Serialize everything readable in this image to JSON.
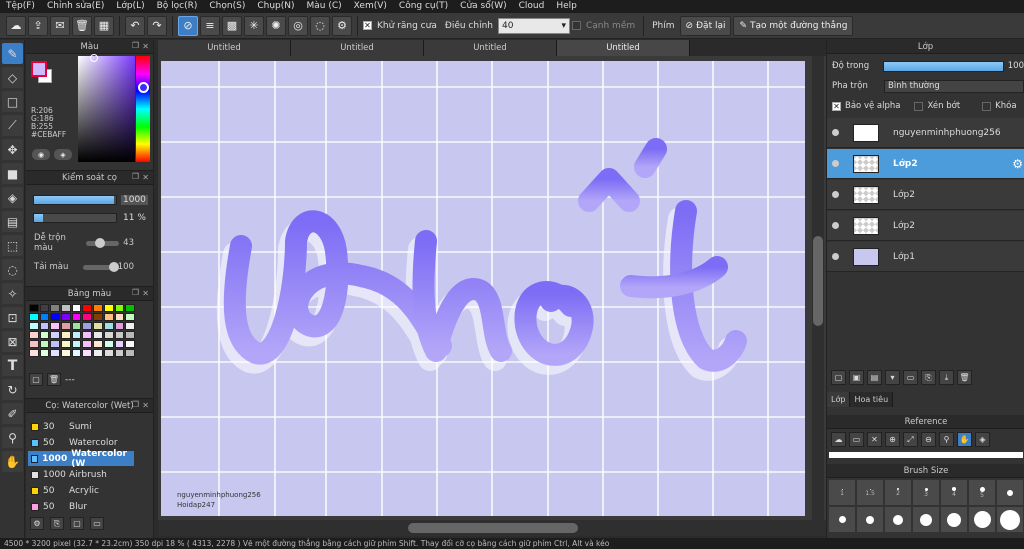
{
  "menu": [
    "Tệp(F)",
    "Chỉnh sửa(E)",
    "Lớp(L)",
    "Bộ lọc(R)",
    "Chọn(S)",
    "Chụp(N)",
    "Màu (C)",
    "Xem(V)",
    "Công cụ(T)",
    "Cửa sổ(W)",
    "Cloud",
    "Help"
  ],
  "toolbar": {
    "antialias_label": "Khử răng cưa",
    "correction_label": "Điều chỉnh",
    "correction_value": "40",
    "smooth_edge_label": "Cạnh mềm",
    "shortcut_label": "Phím",
    "reset_label": "Đặt lại",
    "straight_line_label": "Tạo một đường thẳng"
  },
  "color_panel": {
    "title": "Màu",
    "r": "R:206",
    "g": "G:186",
    "b": "B:255",
    "hex": "#CEBAFF",
    "fg_color": "#CEBAFF"
  },
  "brush_control": {
    "title": "Kiểm soát cọ",
    "size_value": "1000",
    "opacity_value": "11 %",
    "size_fill": 0.98,
    "opacity_fill": 0.11,
    "blend_label": "Dễ trộn màu",
    "blend_value": "43",
    "blend_fill": 0.43,
    "amount_label": "Tải màu",
    "amount_value": "100",
    "amount_fill": 1.0
  },
  "palette_panel": {
    "title": "Bảng màu",
    "footer_text": "---",
    "colors": [
      "#000000",
      "#404040",
      "#808080",
      "#c0c0c0",
      "#ffffff",
      "#ff0000",
      "#ff8000",
      "#ffff00",
      "#80ff00",
      "#00c000",
      "#00ffff",
      "#0080ff",
      "#0000ff",
      "#8000ff",
      "#ff00ff",
      "#ff0080",
      "#804000",
      "#ffc080",
      "#ffe0c0",
      "#c0ffc0",
      "#c0ffff",
      "#c0c0ff",
      "#ffc0ff",
      "#e0a0a0",
      "#a0e0a0",
      "#a0a0e0",
      "#e0e0a0",
      "#a0e0e0",
      "#e0a0e0",
      "#f0f0f0",
      "#ffd0d0",
      "#d0ffd0",
      "#d0d0ff",
      "#fff0c0",
      "#c0f0ff",
      "#f0c0ff",
      "#e8e8e8",
      "#d8d8d8",
      "#c8c8c8",
      "#b8b8b8",
      "#f8c0c0",
      "#c0f8c0",
      "#c0c0f8",
      "#f8f8c0",
      "#c0f8f8",
      "#f8c0f8",
      "#ffe8d0",
      "#d0ffe8",
      "#e8d0ff",
      "#fafafa",
      "#ffe0e0",
      "#e0ffe0",
      "#e0e0ff",
      "#fff8e0",
      "#e0f8ff",
      "#f8e0ff",
      "#eeeeee",
      "#dddddd",
      "#cccccc",
      "#bbbbbb"
    ]
  },
  "brush_list": {
    "title": "Cọ: Watercolor (Wet)",
    "items": [
      {
        "size": "30",
        "name": "Sumi",
        "color": "#ffd400"
      },
      {
        "size": "50",
        "name": "Watercolor",
        "color": "#5bc0ff"
      },
      {
        "size": "1000",
        "name": "Watercolor (W",
        "color": "#5bc0ff"
      },
      {
        "size": "1000",
        "name": "Airbrush",
        "color": "#e0e0e0"
      },
      {
        "size": "50",
        "name": "Acrylic",
        "color": "#ffd400"
      },
      {
        "size": "50",
        "name": "Blur",
        "color": "#ff9ee0"
      }
    ]
  },
  "doc_tabs": [
    "Untitled",
    "Untitled",
    "Untitled",
    "Untitled"
  ],
  "canvas": {
    "watermark_line1": "nguyenminhphuong256",
    "watermark_line2": "Hoidap247"
  },
  "status": "4500 * 3200 pixel  (32.7 * 23.2cm)  350 dpi  18 %  ( 4313, 2278 )  Vẽ một đường thẳng bằng cách giữ phím Shift. Thay đổi cỡ cọ bằng cách giữ phím Ctrl, Alt và kéo",
  "layers_panel": {
    "title": "Lớp",
    "opacity_label": "Độ trong",
    "opacity_value": "100",
    "blend_label": "Pha trộn",
    "blend_value": "Bình thường",
    "protect_alpha_label": "Bảo vệ alpha",
    "clipping_label": "Xén bớt",
    "lock_label": "Khóa",
    "layers": [
      {
        "name": "nguyenminhphuong256",
        "active": false
      },
      {
        "name": "Lớp2",
        "active": true
      },
      {
        "name": "Lớp2",
        "active": false
      },
      {
        "name": "Lớp2",
        "active": false
      },
      {
        "name": "Lớp1",
        "active": false
      }
    ],
    "tabs": [
      "Lớp",
      "Hoa tiêu"
    ]
  },
  "reference_panel": {
    "title": "Reference"
  },
  "brush_size_panel": {
    "title": "Brush Size",
    "sizes": [
      "1",
      "1.5",
      "2",
      "3",
      "4",
      "5"
    ]
  }
}
